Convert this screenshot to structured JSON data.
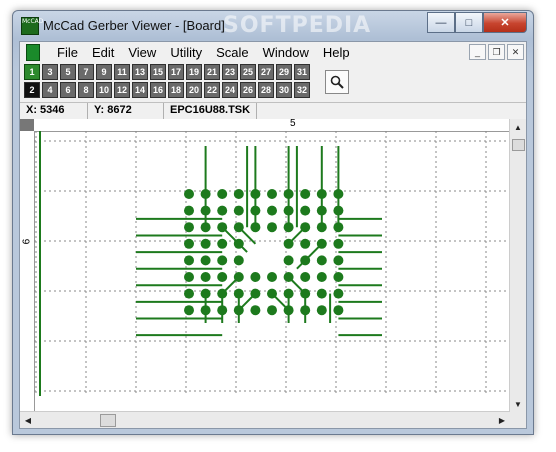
{
  "window": {
    "title": "McCad Gerber Viewer - [Board]",
    "watermark": "SOFTPEDIA",
    "app_icon_text": "McCAD"
  },
  "caption_buttons": {
    "minimize": "—",
    "maximize": "□",
    "close": "✕"
  },
  "menu": [
    "File",
    "Edit",
    "View",
    "Utility",
    "Scale",
    "Window",
    "Help"
  ],
  "mdi_buttons": {
    "minimize": "_",
    "restore": "❐",
    "close": "✕"
  },
  "layers_top": [
    "1",
    "3",
    "5",
    "7",
    "9",
    "11",
    "13",
    "15",
    "17",
    "19",
    "21",
    "23",
    "25",
    "27",
    "29",
    "31"
  ],
  "layers_bottom": [
    "2",
    "4",
    "6",
    "8",
    "10",
    "12",
    "14",
    "16",
    "18",
    "20",
    "22",
    "24",
    "26",
    "28",
    "30",
    "32"
  ],
  "status": {
    "x": "X: 5346",
    "y": "Y: 8672",
    "file": "EPC16U88.TSK"
  },
  "ruler": {
    "top_label": "5",
    "left_label": "9"
  },
  "colors": {
    "trace": "#1d7a1d",
    "grid": "#888888",
    "active_layer": "#2d8a2d"
  },
  "icons": {
    "zoom": "magnifier-icon"
  }
}
